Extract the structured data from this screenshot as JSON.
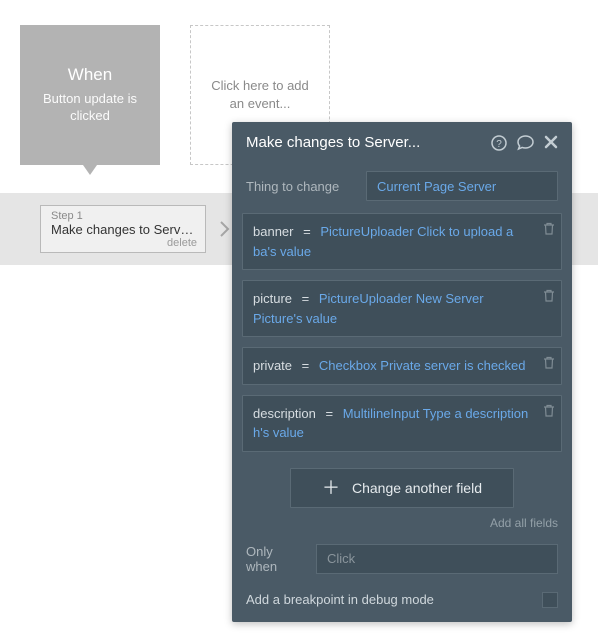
{
  "event": {
    "title": "When",
    "subtitle": "Button update is clicked"
  },
  "add_event_placeholder": "Click here to add an event...",
  "steps": [
    {
      "num_label": "Step 1",
      "title": "Make changes to Server...",
      "delete_label": "delete"
    }
  ],
  "panel": {
    "title": "Make changes to Server...",
    "thing_label": "Thing to change",
    "thing_value": "Current Page Server",
    "fields": [
      {
        "name": "banner",
        "eq": "=",
        "value": "PictureUploader Click to upload a ba's value"
      },
      {
        "name": "picture",
        "eq": "=",
        "value": "PictureUploader New Server Picture's value"
      },
      {
        "name": "private",
        "eq": "=",
        "value": "Checkbox Private server is checked"
      },
      {
        "name": "description",
        "eq": "=",
        "value": "MultilineInput Type a description h's value"
      }
    ],
    "change_another_label": "Change another field",
    "add_all_label": "Add all fields",
    "only_when_label": "Only when",
    "only_when_placeholder": "Click",
    "debug_label": "Add a breakpoint in debug mode"
  }
}
